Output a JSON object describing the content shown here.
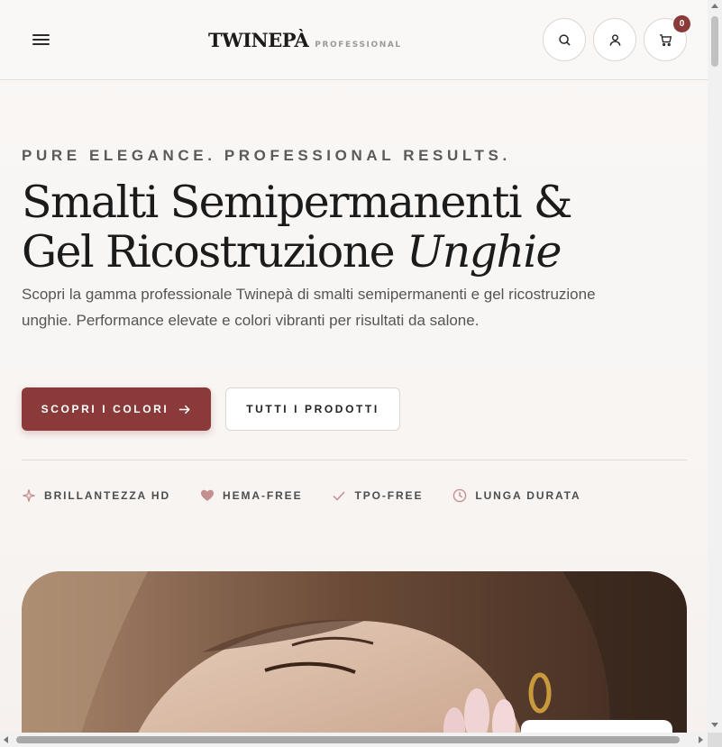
{
  "header": {
    "menu_icon": "hamburger-menu-icon",
    "logo": {
      "word": "TWINEPÀ",
      "sub": "PROFESSIONAL"
    },
    "actions": [
      {
        "name": "search",
        "icon": "search-icon"
      },
      {
        "name": "account",
        "icon": "user-icon"
      },
      {
        "name": "cart",
        "icon": "cart-icon",
        "badge": "0"
      }
    ]
  },
  "hero": {
    "eyebrow": "PURE ELEGANCE. PROFESSIONAL RESULTS.",
    "headline_line1": "Smalti Semipermanenti &",
    "headline_line2_plain": "Gel Ricostruzione ",
    "headline_line2_italic": "Unghie",
    "lead": "Scopri la gamma professionale Twinepà di smalti semipermanenti e gel ricostruzione unghie. Performance elevate e colori vibranti per risultati da salone.",
    "primary_cta": "SCOPRI I COLORI",
    "secondary_cta": "TUTTI I PRODOTTI"
  },
  "features": [
    {
      "label": "BRILLANTEZZA HD",
      "icon": "sparkle-icon"
    },
    {
      "label": "HEMA-FREE",
      "icon": "heart-icon"
    },
    {
      "label": "TPO-FREE",
      "icon": "check-icon"
    },
    {
      "label": "LUNGA DURATA",
      "icon": "clock-icon"
    }
  ],
  "colors": {
    "accent": "#8b3a3a",
    "feature_icon": "#c48f8f",
    "background": "#f8f5f3"
  }
}
